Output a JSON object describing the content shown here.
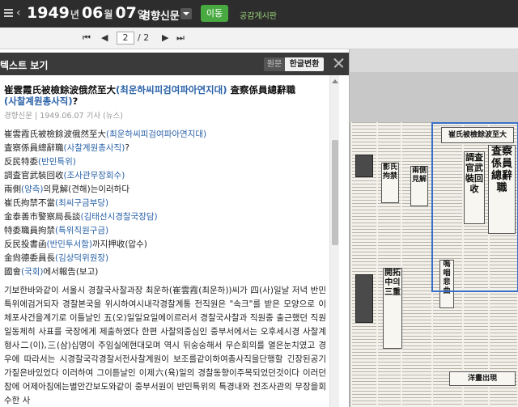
{
  "topbar": {
    "year": "1949",
    "year_unit": "년",
    "month": "06",
    "month_unit": "월",
    "day": "07",
    "day_unit": "일",
    "newspaper": "경향신문",
    "go_label": "이동",
    "board_label": "공감게시판"
  },
  "pagenav": {
    "current_page": "2",
    "total_pages": "/ 2"
  },
  "panel": {
    "title": "텍스트 보기",
    "original_label": "원문",
    "convert_label": "한글변환"
  },
  "article": {
    "title_hanja": "崔雲霞氏被檢餘波俄然至大",
    "title_paren": "(최운하씨피검여파아연지대)",
    "title_mid": " 査察係員總辭職",
    "title_paren2": "(사찰계원총사직)",
    "title_end": "?",
    "meta": "경향신문 | 1949.06.07 기사 (뉴스)",
    "lines": [
      {
        "main": "崔雲霞氏被檢餘波俄然至大",
        "paren": "(최운하씨피검여파아연지대)",
        "tail": ""
      },
      {
        "main": "査察係員總辭職",
        "paren": "(사찰계원총사직)",
        "tail": "?"
      },
      {
        "main": "反民特委",
        "paren": "(반민특위)",
        "tail": ""
      },
      {
        "main": "調査官武裝回收",
        "paren": "(조사관무장회수)",
        "tail": ""
      },
      {
        "main": "兩側",
        "paren": "(양측)",
        "tail": "의見解(견해)는이러하다"
      },
      {
        "main": "崔氏拘禁不當",
        "paren": "(최씨구금부당)",
        "tail": ""
      },
      {
        "main": "金泰善市警察局長談",
        "paren": "(김태선시경찰국장담)",
        "tail": ""
      },
      {
        "main": "特委職員拘禁",
        "paren": "(특위직원구금)",
        "tail": ""
      },
      {
        "main": "反民投書函",
        "paren": "(반민투서함)",
        "tail": "까지押收(압수)"
      },
      {
        "main": "金尙德委員長",
        "paren": "(김상덕위원장)",
        "tail": ""
      },
      {
        "main": "國會",
        "paren": "(국회)",
        "tail": "에서報告(보고)"
      }
    ],
    "body": "기보한바와같이 서울시 경찰국사찰과장 최운하(崔雲霞(최운하))씨가 四(사)일날 저녁 반민특위에검거되자 경찰본국을 위시하여시내각경찰계통 전직원은 \"속크\"를 받은 모양으로 이체포사건을계기로 이틀날인 五(오)일일요일에이르러서 경찰국사찰과 직원중 출근했던 직원일동체히 사표를 국장에게 제출하였다 한편 사찰의중심인 중부서에서는 오후세시경 사찰계형사二(이),三(삼)십명이 주임실에현대모며 역시 뒤숭숭해서 무슨회의를 열은눈치였고 경우에 따라서는 시경찰국각경찰서전사찰계원이 보조를같이하여총사직을단행할 긴장된공기가짙은바있었다 이러하여 그이튿날인 이제六(육)일의 경찰동향이주목되었던것이다 이러던참에 어제아침에는별안간보도와같이 중부서원이 반민특위의 특경내와 전조사관의 무장을회수한 사"
  }
}
